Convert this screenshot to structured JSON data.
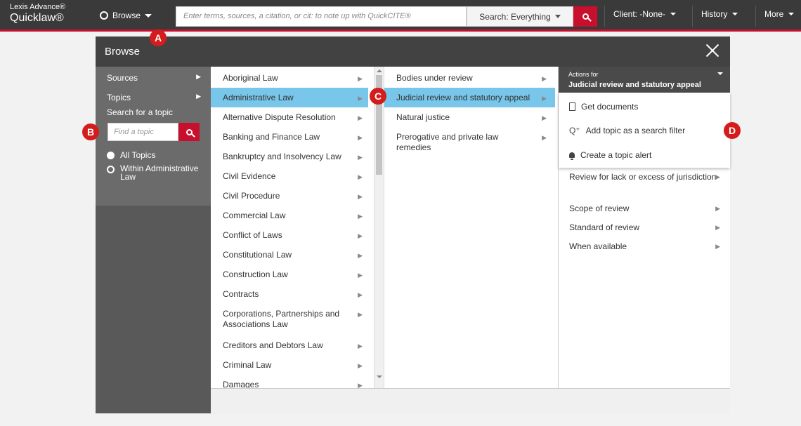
{
  "brand": {
    "line1": "Lexis Advance®",
    "line2": "Quicklaw®"
  },
  "topbar": {
    "browse_label": "Browse",
    "search_placeholder": "Enter terms, sources, a citation, or cit: to note up with QuickCITE®",
    "search_scope": "Search: Everything",
    "client": "Client: -None-",
    "history": "History",
    "more": "More"
  },
  "panel": {
    "title": "Browse"
  },
  "left": {
    "sources": "Sources",
    "topics": "Topics",
    "search_label": "Search for a topic",
    "find_placeholder": "Find a topic",
    "radio_all": "All Topics",
    "radio_within": "Within Administrative Law"
  },
  "topics": [
    "Aboriginal Law",
    "Administrative Law",
    "Alternative Dispute Resolution",
    "Banking and Finance Law",
    "Bankruptcy and Insolvency Law",
    "Civil Evidence",
    "Civil Procedure",
    "Commercial Law",
    "Conflict of Laws",
    "Constitutional Law",
    "Construction Law",
    "Contracts",
    "Corporations, Partnerships and Associations Law",
    "Creditors and Debtors Law",
    "Criminal Law",
    "Damages"
  ],
  "subtopics": [
    "Bodies under review",
    "Judicial review and statutory appeal",
    "Natural justice",
    "Prerogative and private law remedies"
  ],
  "actions": {
    "small": "Actions for",
    "big": "Judicial review and statutory appeal",
    "get_documents": "Get documents",
    "add_filter": "Add topic as a search filter",
    "create_alert": "Create a topic alert"
  },
  "leaf_topics": [
    "Review for lack or excess of jurisdiction",
    "Scope of review",
    "Standard of review",
    "When available"
  ],
  "callouts": {
    "a": "A",
    "b": "B",
    "c": "C",
    "d": "D"
  }
}
